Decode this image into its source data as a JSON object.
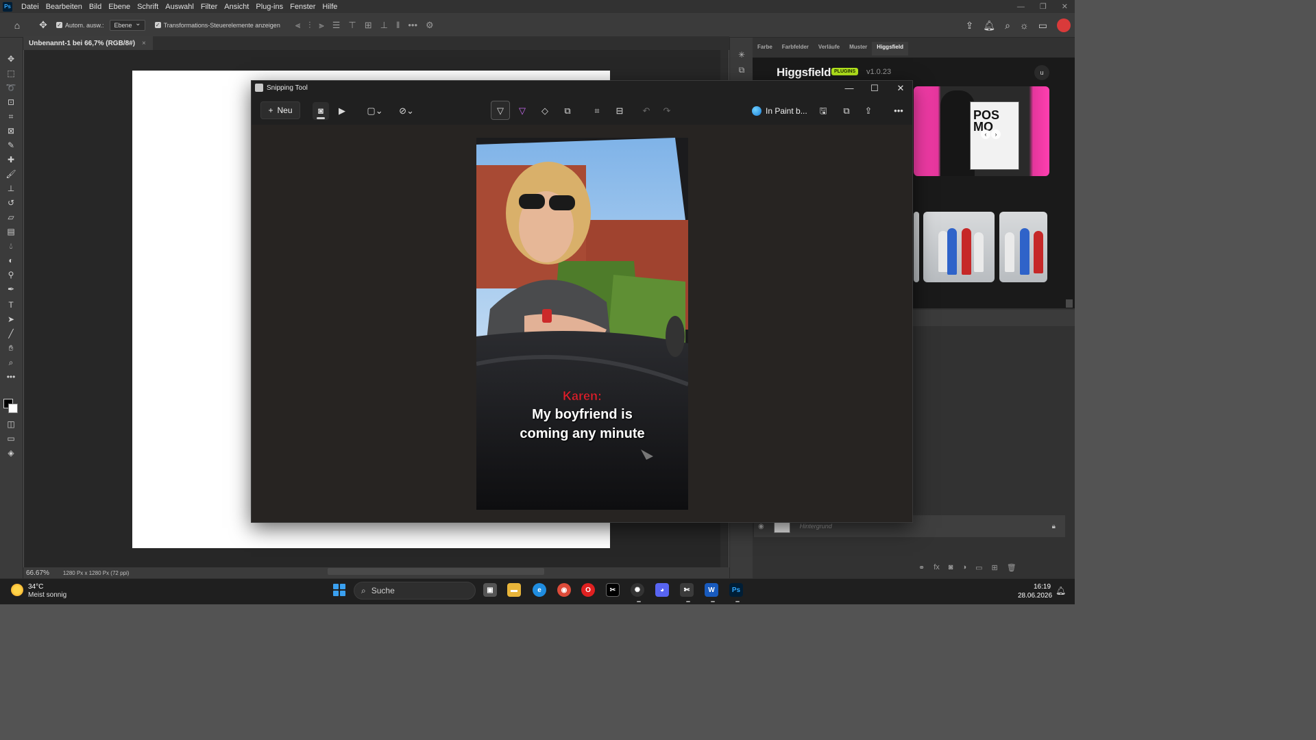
{
  "menubar": {
    "items": [
      "Datei",
      "Bearbeiten",
      "Bild",
      "Ebene",
      "Schrift",
      "Auswahl",
      "Filter",
      "Ansicht",
      "Plug-ins",
      "Fenster",
      "Hilfe"
    ]
  },
  "options": {
    "auto_select_label": "Autom. ausw.:",
    "layer_dropdown": "Ebene",
    "transform_label": "Transformations-Steuerelemente anzeigen"
  },
  "document": {
    "tab_title": "Unbenannt-1 bei 66,7% (RGB/8#)",
    "zoom": "66.67%",
    "info": "1280 Px x 1280 Px (72 ppi)"
  },
  "panel": {
    "tabs": [
      "Farbe",
      "Farbfelder",
      "Verläufe",
      "Muster",
      "Higgsfield"
    ],
    "active_tab": "Higgsfield",
    "higgsfield": {
      "title": "Higgsfield",
      "badge": "PLUGINS",
      "version": "v1.0.23",
      "user_initial": "u",
      "poster_text": "POS\nMO"
    },
    "layer": {
      "name": "Hintergrund"
    }
  },
  "snipping_tool": {
    "title": "Snipping Tool",
    "new_label": "Neu",
    "paint_label": "In Paint b...",
    "caption_name": "Karen:",
    "caption_line1": "My boyfriend is",
    "caption_line2": "coming any minute"
  },
  "taskbar": {
    "weather_temp": "34°C",
    "weather_desc": "Meist sonnig",
    "search_placeholder": "Suche",
    "time": "16:19",
    "date": "28.06.2026"
  },
  "colors": {
    "ps_accent": "#31a8ff",
    "higgsfield_badge": "#b5e61d",
    "caption_red": "#e51d2a"
  }
}
